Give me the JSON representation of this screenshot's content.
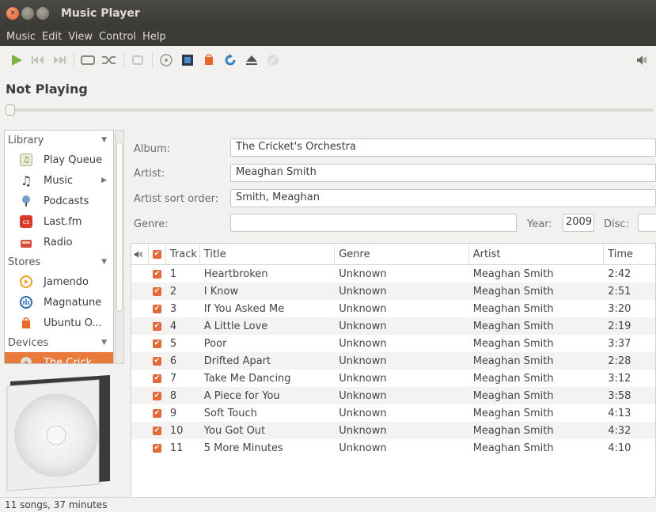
{
  "window": {
    "title": "Music Player"
  },
  "menubar": {
    "items": [
      "Music",
      "Edit",
      "View",
      "Control",
      "Help"
    ]
  },
  "player": {
    "now_playing": "Not Playing"
  },
  "sidebar": {
    "groups": [
      {
        "label": "Library",
        "items": [
          {
            "label": "Play Queue",
            "icon": "play-queue-icon"
          },
          {
            "label": "Music",
            "icon": "music-note-icon"
          },
          {
            "label": "Podcasts",
            "icon": "podcast-icon"
          },
          {
            "label": "Last.fm",
            "icon": "lastfm-icon"
          },
          {
            "label": "Radio",
            "icon": "radio-icon"
          }
        ]
      },
      {
        "label": "Stores",
        "items": [
          {
            "label": "Jamendo",
            "icon": "jamendo-icon"
          },
          {
            "label": "Magnatune",
            "icon": "magnatune-icon"
          },
          {
            "label": "Ubuntu O...",
            "icon": "ubuntu-one-icon"
          }
        ]
      },
      {
        "label": "Devices",
        "items": [
          {
            "label": "The Crick...",
            "icon": "cd-icon"
          }
        ]
      }
    ]
  },
  "properties": {
    "album_label": "Album:",
    "album_value": "The Cricket's Orchestra",
    "artist_label": "Artist:",
    "artist_value": "Meaghan Smith",
    "sort_label": "Artist sort order:",
    "sort_value": "Smith, Meaghan",
    "genre_label": "Genre:",
    "genre_value": "",
    "year_label": "Year:",
    "year_value": "2009",
    "disc_label": "Disc:",
    "disc_value": ""
  },
  "tracks": {
    "headers": {
      "track": "Track",
      "title": "Title",
      "genre": "Genre",
      "artist": "Artist",
      "time": "Time"
    },
    "rows": [
      {
        "track": "1",
        "title": "Heartbroken",
        "genre": "Unknown",
        "artist": "Meaghan Smith",
        "time": "2:42"
      },
      {
        "track": "2",
        "title": "I Know",
        "genre": "Unknown",
        "artist": "Meaghan Smith",
        "time": "2:51"
      },
      {
        "track": "3",
        "title": "If You Asked Me",
        "genre": "Unknown",
        "artist": "Meaghan Smith",
        "time": "3:20"
      },
      {
        "track": "4",
        "title": "A Little Love",
        "genre": "Unknown",
        "artist": "Meaghan Smith",
        "time": "2:19"
      },
      {
        "track": "5",
        "title": "Poor",
        "genre": "Unknown",
        "artist": "Meaghan Smith",
        "time": "3:37"
      },
      {
        "track": "6",
        "title": "Drifted Apart",
        "genre": "Unknown",
        "artist": "Meaghan Smith",
        "time": "2:28"
      },
      {
        "track": "7",
        "title": "Take Me Dancing",
        "genre": "Unknown",
        "artist": "Meaghan Smith",
        "time": "3:12"
      },
      {
        "track": "8",
        "title": "A Piece for You",
        "genre": "Unknown",
        "artist": "Meaghan Smith",
        "time": "3:58"
      },
      {
        "track": "9",
        "title": "Soft Touch",
        "genre": "Unknown",
        "artist": "Meaghan Smith",
        "time": "4:13"
      },
      {
        "track": "10",
        "title": "You Got Out",
        "genre": "Unknown",
        "artist": "Meaghan Smith",
        "time": "4:32"
      },
      {
        "track": "11",
        "title": "5 More Minutes",
        "genre": "Unknown",
        "artist": "Meaghan Smith",
        "time": "4:10"
      }
    ]
  },
  "status": {
    "text": "11 songs, 37 minutes"
  },
  "colors": {
    "accent": "#e87b3c",
    "play_green": "#7cb342",
    "titlebar": "#3c3b37"
  }
}
